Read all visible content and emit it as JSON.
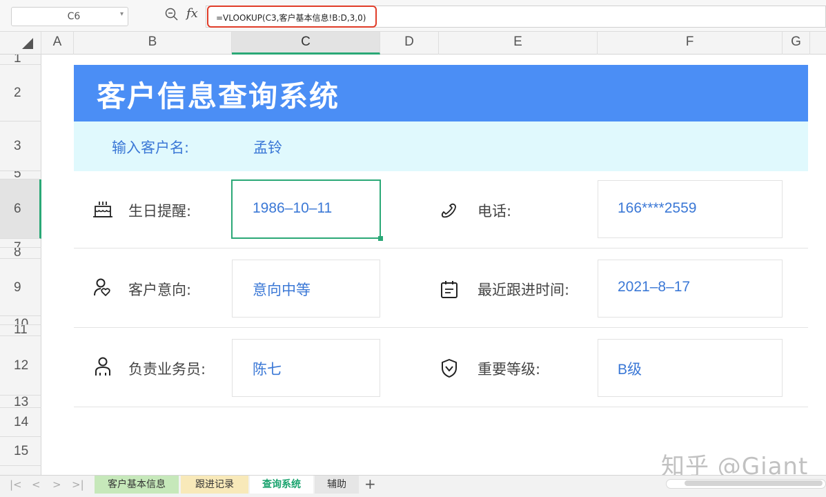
{
  "formula_bar": {
    "cell_ref": "C6",
    "formula": "=VLOOKUP(C3,客户基本信息!B:D,3,0)",
    "fx_label": "fx"
  },
  "columns": [
    "A",
    "B",
    "C",
    "D",
    "E",
    "F",
    "G"
  ],
  "active_column": "C",
  "rows": [
    "1",
    "2",
    "3",
    "5",
    "6",
    "7",
    "8",
    "9",
    "10",
    "11",
    "12",
    "13",
    "14",
    "15"
  ],
  "active_row": "6",
  "sheet": {
    "title": "客户信息查询系统",
    "search_label": "输入客户名:",
    "search_value": "孟铃",
    "fields": {
      "birthday": {
        "label": "生日提醒:",
        "value": "1986–10–11",
        "icon": "cake-icon"
      },
      "phone": {
        "label": "电话:",
        "value": "166****2559",
        "icon": "phone-icon"
      },
      "intent": {
        "label": "客户意向:",
        "value": "意向中等",
        "icon": "user-heart-icon"
      },
      "last_followup": {
        "label": "最近跟进时间:",
        "value": "2021–8–17",
        "icon": "calendar-icon"
      },
      "salesperson": {
        "label": "负责业务员:",
        "value": "陈七",
        "icon": "person-icon"
      },
      "importance": {
        "label": "重要等级:",
        "value": "B级",
        "icon": "shield-check-icon"
      }
    }
  },
  "tabs": {
    "nav": [
      "|<",
      "<",
      ">",
      ">|"
    ],
    "items": [
      "客户基本信息",
      "跟进记录",
      "查询系统",
      "辅助"
    ],
    "active": "查询系统",
    "add_label": "+"
  },
  "watermark": "知乎 @Giant",
  "colors": {
    "title_bar": "#4b8ef5",
    "input_bar": "#e0f9fd",
    "value_text": "#3b78d6",
    "selection": "#2aa876",
    "formula_highlight": "#e03c28"
  }
}
